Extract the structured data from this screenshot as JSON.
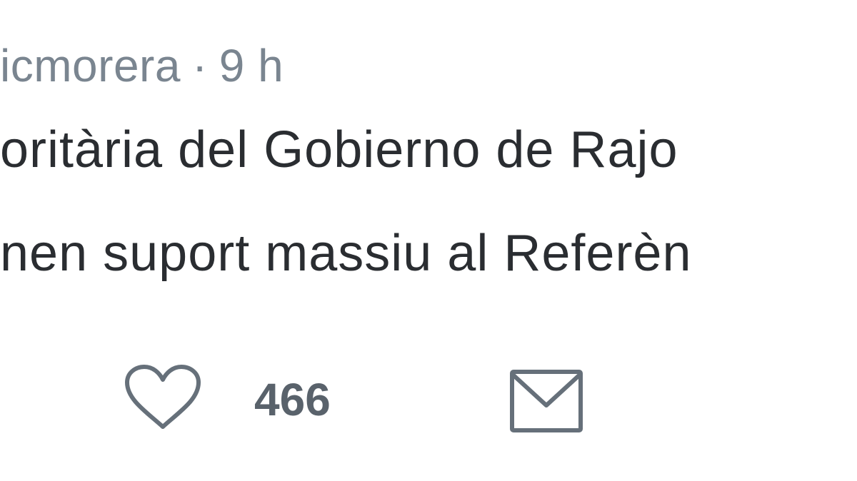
{
  "tweet": {
    "handle": "icmorera",
    "separator": "·",
    "time": "9 h",
    "lines": [
      "oritària del Gobierno de Rajo",
      "nen suport massiu al Referèn"
    ]
  },
  "actions": {
    "like": {
      "icon": "heart-icon",
      "count": "466"
    },
    "message": {
      "icon": "envelope-icon"
    }
  },
  "colors": {
    "meta_text": "#7a8590",
    "body_text": "#2a2d31",
    "icon": "#66707a",
    "count_text": "#59626b",
    "background": "#ffffff"
  }
}
